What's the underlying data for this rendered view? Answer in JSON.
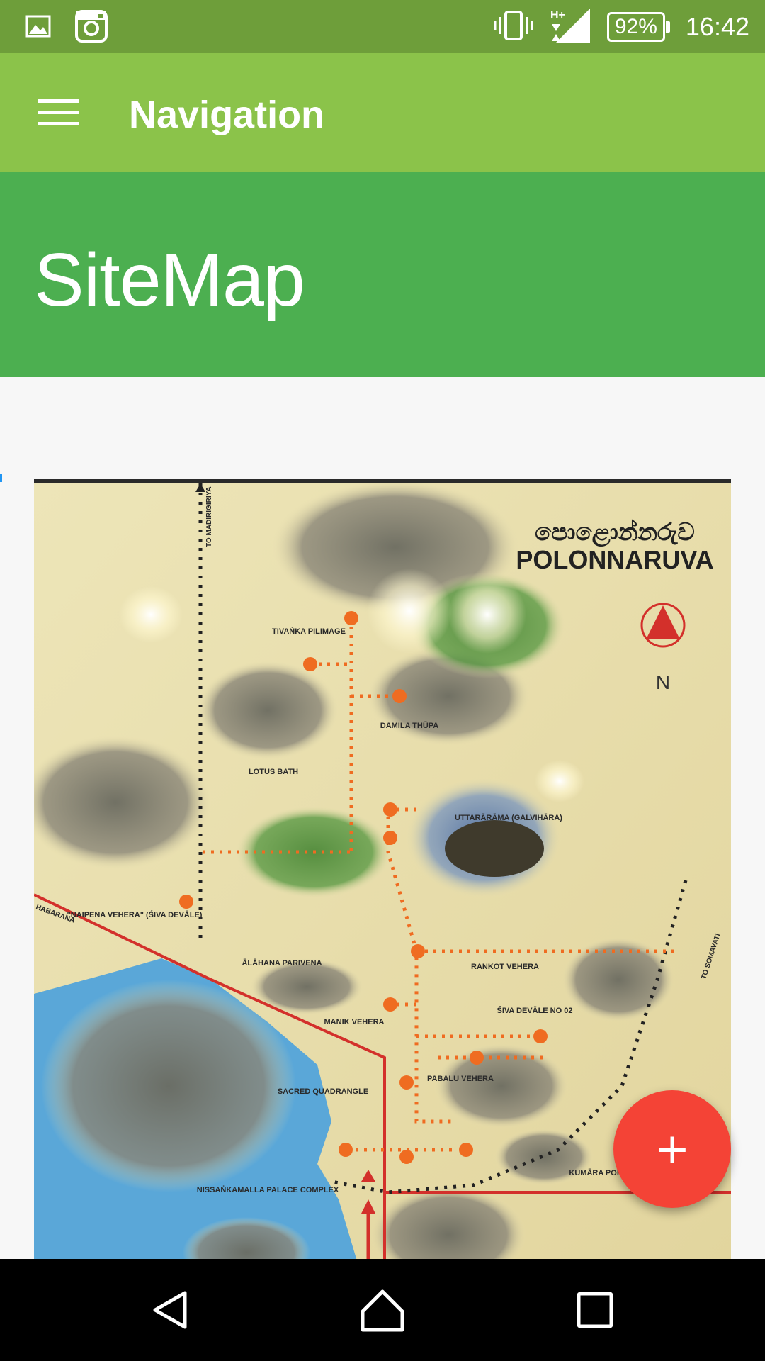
{
  "status_bar": {
    "time": "16:42",
    "battery_percent": "92%",
    "network_type": "H+",
    "icons": [
      "gallery-icon",
      "instagram-icon",
      "vibrate-icon",
      "signal-icon",
      "battery-icon"
    ]
  },
  "app_bar": {
    "title": "Navigation",
    "menu_icon": "hamburger-menu-icon"
  },
  "header": {
    "title": "SiteMap"
  },
  "map": {
    "title_sinhala": "පොළොන්නරුව",
    "title_english": "POLONNARUVA",
    "north_label": "N",
    "sites": [
      "TIVAṄKA PILIMAGE",
      "DAMILA THŪPA",
      "LOTUS BATH",
      "UTTARĀRĀMA (GALVIHĀRA)",
      "\"NAIPENA VEHERA\" (ŚIVA DEVĀLE)",
      "ĀLĀHANA PARIVENA",
      "RANKOT VEHERA",
      "MANIK VEHERA",
      "ŚIVA DEVĀLE NO 02",
      "PABALU VEHERA",
      "SACRED QUADRANGLE",
      "NISSAṄKAMALLA PALACE COMPLEX",
      "KUMĀRA POKUNA"
    ],
    "road_labels": [
      "TO MADIRIGIRIYA",
      "HABARANA",
      "TO SOMAVATI"
    ]
  },
  "fab": {
    "label": "+",
    "color": "#f44336"
  },
  "nav_bar": {
    "buttons": [
      "back-icon",
      "home-icon",
      "recents-icon"
    ]
  },
  "colors": {
    "status_bar": "#6e9e3a",
    "app_bar": "#8bc34a",
    "header": "#4caf50",
    "map_water": "#5aa7d8",
    "map_background": "#e8e0b0",
    "route": "#ef6c21"
  }
}
